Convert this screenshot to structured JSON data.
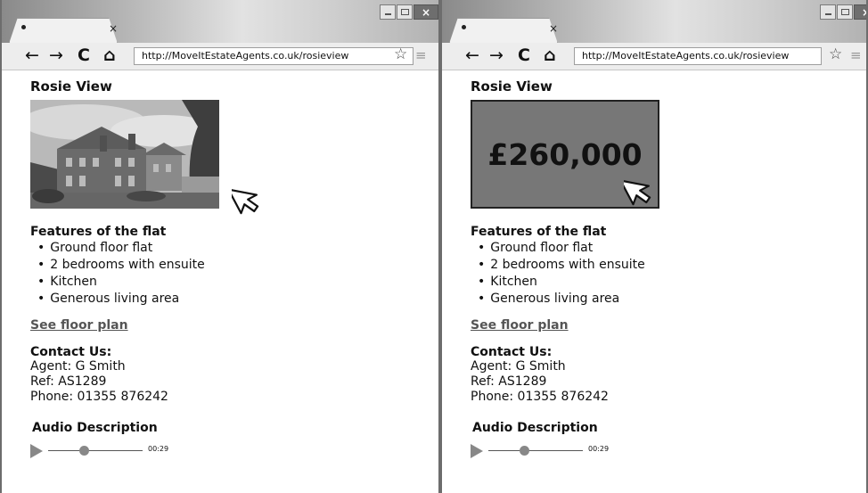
{
  "browser": {
    "url": "http://MoveItEstateAgents.co.uk/rosieview",
    "tab_close": "×",
    "close_glyph": "×"
  },
  "page": {
    "title": "Rosie View",
    "price": "£260,000",
    "features_title": "Features of the flat",
    "features": [
      "Ground floor flat",
      "2 bedrooms with ensuite",
      "Kitchen",
      "Generous living area"
    ],
    "floor_plan_link": "See floor plan",
    "contact": {
      "title": "Contact Us:",
      "agent": "Agent: G Smith",
      "ref": "Ref: AS1289",
      "phone": "Phone: 01355 876242"
    },
    "audio": {
      "title": "Audio Description",
      "time": "00:29",
      "progress": 0.38
    }
  },
  "icons": {
    "back": "←",
    "forward": "→",
    "reload": "C",
    "home": "⌂",
    "star": "☆",
    "menu": "≡",
    "bullet": "•"
  }
}
